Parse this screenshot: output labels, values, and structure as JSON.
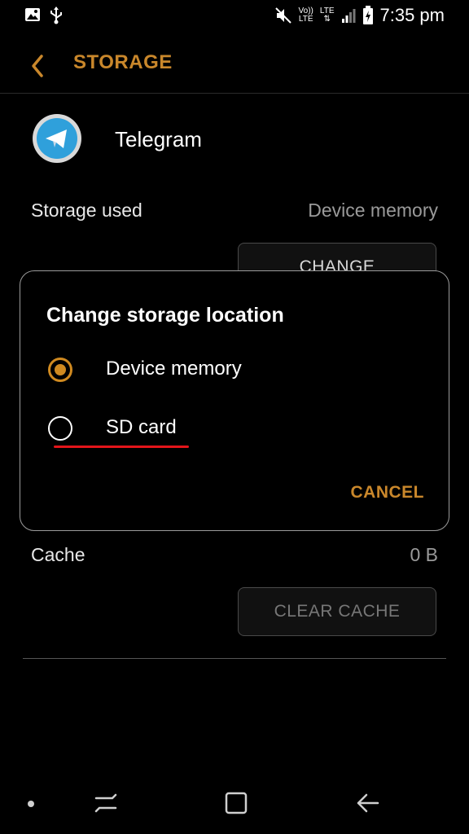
{
  "status_bar": {
    "time": "7:35 pm",
    "volte_top": "Vo))",
    "volte_bottom": "LTE",
    "lte": "LTE",
    "icons": [
      "image-icon",
      "usb-icon",
      "mute-icon",
      "volte-icon",
      "lte-icon",
      "signal-icon",
      "battery-charging-icon"
    ]
  },
  "header": {
    "title": "STORAGE",
    "back_icon": "chevron-left-icon"
  },
  "app": {
    "name": "Telegram",
    "icon": "telegram-icon"
  },
  "storage_used": {
    "label": "Storage used",
    "value": "Device memory",
    "change_label": "CHANGE"
  },
  "cache": {
    "label": "Cache",
    "value": "0 B",
    "clear_label": "CLEAR CACHE"
  },
  "dialog": {
    "title": "Change storage location",
    "options": [
      {
        "label": "Device memory",
        "selected": true
      },
      {
        "label": "SD card",
        "selected": false
      }
    ],
    "cancel_label": "CANCEL"
  },
  "colors": {
    "accent": "#c9872b",
    "highlight_underline": "#e3151a",
    "background": "#000000"
  },
  "nav_bar": {
    "icons": [
      "dot-icon",
      "recents-icon",
      "home-icon",
      "back-arrow-icon"
    ]
  }
}
